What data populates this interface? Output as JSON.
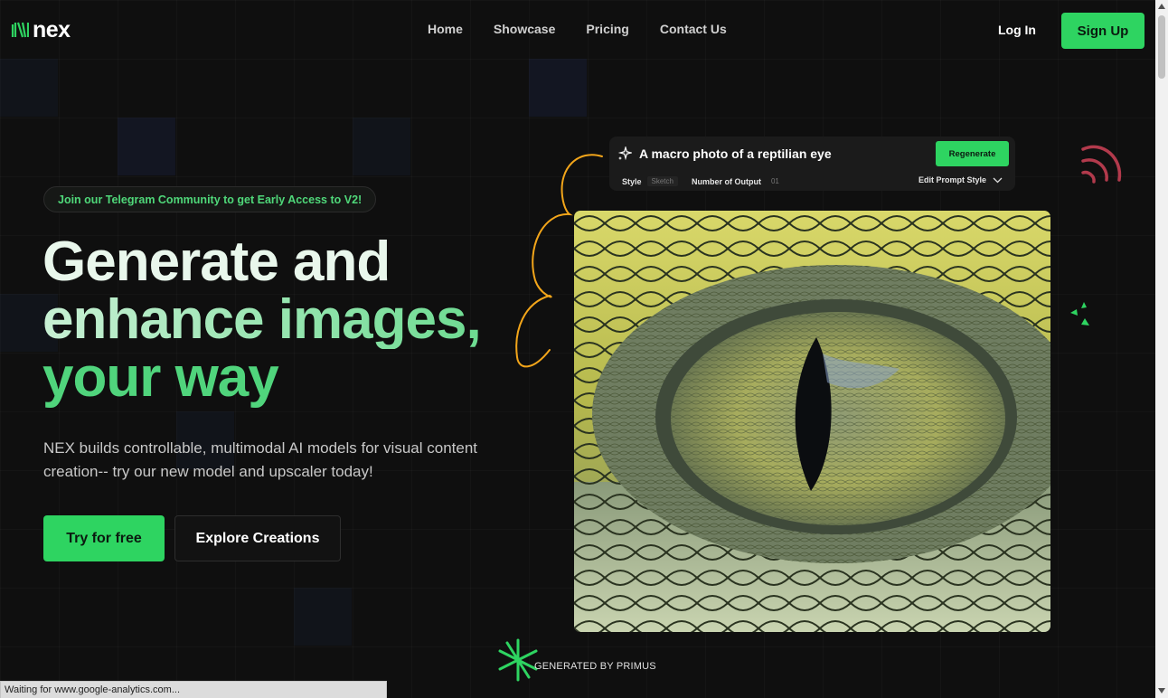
{
  "brand": {
    "name": "nex",
    "accent": "#2ed461"
  },
  "nav": {
    "links": [
      "Home",
      "Showcase",
      "Pricing",
      "Contact Us"
    ],
    "login": "Log In",
    "signup": "Sign Up"
  },
  "hero": {
    "pill": "Join our Telegram Community to get Early Access to V2!",
    "headline": [
      "Generate and",
      "enhance images,",
      "your way"
    ],
    "subtitle": "NEX builds controllable, multimodal AI models for visual content creation-- try our new model and upscaler today!",
    "cta_primary": "Try for free",
    "cta_secondary": "Explore Creations"
  },
  "prompt_card": {
    "icon": "sparkle-icon",
    "prompt": "A macro photo of a reptilian eye",
    "regenerate": "Regenerate",
    "style_label": "Style",
    "style_value": "Sketch",
    "outputs_label": "Number of Output",
    "outputs_value": "01",
    "edit_label": "Edit Prompt Style"
  },
  "image": {
    "subject": "reptile-eye-image"
  },
  "footer_note": "GENERATED BY PRIMUS",
  "status_bar": "Waiting for www.google-analytics.com..."
}
